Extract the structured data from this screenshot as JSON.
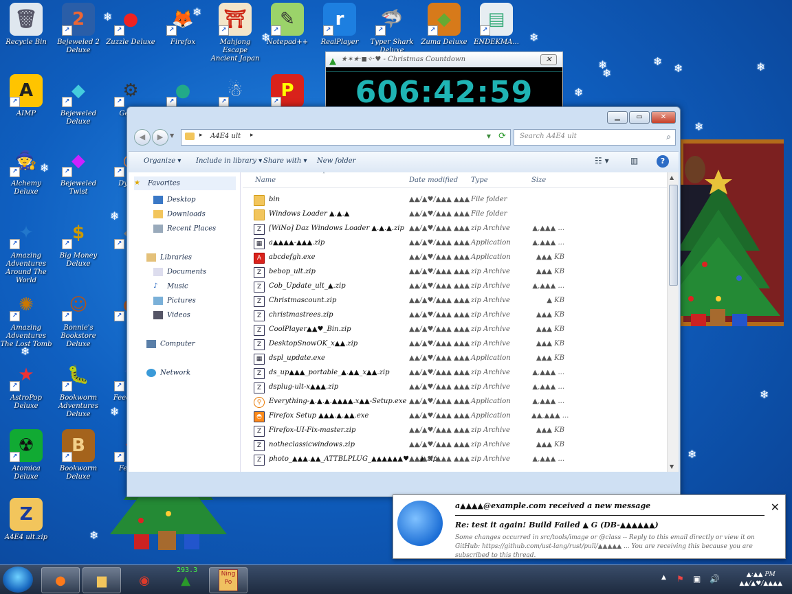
{
  "desktop_icons": [
    {
      "id": "recycle-bin",
      "label": "Recycle Bin",
      "glyph": "🗑",
      "bg": "#dfe7ef",
      "fg": "#556",
      "shortcut": false
    },
    {
      "id": "bejeweled2",
      "label": "Bejeweled 2 Deluxe",
      "glyph": "2",
      "bg": "#2a5ea8",
      "fg": "#e63"
    },
    {
      "id": "zuzzle",
      "label": "Zuzzle Deluxe",
      "glyph": "●",
      "bg": "transparent",
      "fg": "#e22"
    },
    {
      "id": "firefox",
      "label": "Firefox",
      "glyph": "🦊",
      "bg": "transparent",
      "fg": "#f70"
    },
    {
      "id": "mahjong",
      "label": "Mahjong Escape Ancient Japan",
      "glyph": "⛩",
      "bg": "#f3e5c9",
      "fg": "#c21"
    },
    {
      "id": "notepad",
      "label": "Notepad++",
      "glyph": "✎",
      "bg": "#9bd36a",
      "fg": "#333"
    },
    {
      "id": "realplayer",
      "label": "RealPlayer",
      "glyph": "r",
      "bg": "#1d7fe0",
      "fg": "#fff"
    },
    {
      "id": "typer-shark",
      "label": "Typer Shark Deluxe",
      "glyph": "🦈",
      "bg": "transparent",
      "fg": "#ccc"
    },
    {
      "id": "zuma",
      "label": "Zuma Deluxe",
      "glyph": "◆",
      "bg": "#d77a1a",
      "fg": "#6a3"
    },
    {
      "id": "endekma",
      "label": "ENDEKMA...",
      "glyph": "▤",
      "bg": "#e6edf2",
      "fg": "#3a7"
    },
    {
      "id": "aimp",
      "label": "AIMP",
      "glyph": "A",
      "bg": "#ffc400",
      "fg": "#222"
    },
    {
      "id": "bejeweled",
      "label": "Bejeweled Deluxe",
      "glyph": "◆",
      "bg": "transparent",
      "fg": "#4cd"
    },
    {
      "id": "gear",
      "label": "Gear...",
      "glyph": "⚙",
      "bg": "transparent",
      "fg": "#333"
    },
    {
      "id": "chrome",
      "label": "",
      "glyph": "●",
      "bg": "transparent",
      "fg": "#2a8"
    },
    {
      "id": "yeti",
      "label": "",
      "glyph": "☃",
      "bg": "transparent",
      "fg": "#ddd"
    },
    {
      "id": "p-game",
      "label": "",
      "glyph": "P",
      "bg": "#d9221b",
      "fg": "#ff0"
    },
    {
      "id": "alchemy",
      "label": "Alchemy Deluxe",
      "glyph": "🧙",
      "bg": "transparent",
      "fg": "#c33"
    },
    {
      "id": "bejeweled-twist",
      "label": "Bejeweled Twist",
      "glyph": "◆",
      "bg": "transparent",
      "fg": "#c2f"
    },
    {
      "id": "dyno",
      "label": "Dyno...",
      "glyph": "◎",
      "bg": "transparent",
      "fg": "#e84"
    },
    {
      "id": "aaaw",
      "label": "Amazing Adventures Around The World",
      "glyph": "✦",
      "bg": "transparent",
      "fg": "#27c"
    },
    {
      "id": "big-money",
      "label": "Big Money Deluxe",
      "glyph": "$",
      "bg": "transparent",
      "fg": "#c90"
    },
    {
      "id": "bejeweled3",
      "label": "...",
      "glyph": "◆",
      "bg": "transparent",
      "fg": "#888"
    },
    {
      "id": "aalt",
      "label": "Amazing Adventures The Lost Tomb",
      "glyph": "✺",
      "bg": "transparent",
      "fg": "#c70"
    },
    {
      "id": "bonnies",
      "label": "Bonnie's Bookstore Deluxe",
      "glyph": "☺",
      "bg": "transparent",
      "fg": "#a52"
    },
    {
      "id": "blank1",
      "label": "...",
      "glyph": "◐",
      "bg": "transparent",
      "fg": "#a52"
    },
    {
      "id": "astropop",
      "label": "AstroPop Deluxe",
      "glyph": "★",
      "bg": "transparent",
      "fg": "#e33"
    },
    {
      "id": "bookworm-adv",
      "label": "Bookworm Adventures Deluxe",
      "glyph": "🐛",
      "bg": "transparent",
      "fg": "#5b3"
    },
    {
      "id": "feeding",
      "label": "Feeding...",
      "glyph": "♆",
      "bg": "transparent",
      "fg": "#36c"
    },
    {
      "id": "atomica",
      "label": "Atomica Deluxe",
      "glyph": "☢",
      "bg": "#1a3",
      "fg": "#111"
    },
    {
      "id": "bookworm",
      "label": "Bookworm Deluxe",
      "glyph": "B",
      "bg": "#a4631c",
      "fg": "#f3d08a"
    },
    {
      "id": "feed2",
      "label": "Feed...",
      "glyph": "♦",
      "bg": "transparent",
      "fg": "#c33"
    },
    {
      "id": "zip-file",
      "label": "A4E4 ult.zip",
      "glyph": "Z",
      "bg": "#f2c55c",
      "fg": "#1a3b9c",
      "shortcut": false
    }
  ],
  "countdown": {
    "title": "★✶★·◼✧·♥ - Christmas Countdown",
    "time": "606:42:59"
  },
  "explorer": {
    "breadcrumb": "A4E4 ult",
    "search_placeholder": "Search A4E4 ult",
    "toolbar": {
      "organize": "Organize",
      "include": "Include in library",
      "share": "Share with",
      "new_folder": "New folder"
    },
    "nav": {
      "favorites": "Favorites",
      "desktop": "Desktop",
      "downloads": "Downloads",
      "recent": "Recent Places",
      "libraries": "Libraries",
      "documents": "Documents",
      "music": "Music",
      "pictures": "Pictures",
      "videos": "Videos",
      "computer": "Computer",
      "network": "Network"
    },
    "headers": {
      "name": "Name",
      "date": "Date modified",
      "type": "Type",
      "size": "Size"
    },
    "files": [
      {
        "icon": "folder",
        "name": "bin",
        "date": "▲▲/▲♥/▲▲▲ ▲▲▲",
        "type": "File folder",
        "size": ""
      },
      {
        "icon": "folder",
        "name": "Windows Loader ▲.▲.▲",
        "date": "▲▲/▲♥/▲▲▲ ▲▲▲",
        "type": "File folder",
        "size": ""
      },
      {
        "icon": "zip",
        "name": "[WiNo] Daz Windows Loader ▲.▲.▲.zip",
        "date": "▲▲/▲♥/▲▲▲ ▲▲▲",
        "type": "zip Archive",
        "size": "▲,▲▲▲ ..."
      },
      {
        "icon": "app",
        "name": "a▲▲▲▲-▲▲▲.zip",
        "date": "▲▲/▲♥/▲▲▲ ▲▲▲",
        "type": "Application",
        "size": "▲,▲▲▲ ..."
      },
      {
        "icon": "red",
        "name": "abcdefgh.exe",
        "date": "▲▲/▲♥/▲▲▲ ▲▲▲",
        "type": "Application",
        "size": "▲▲▲ KB"
      },
      {
        "icon": "zip",
        "name": "bebop_ult.zip",
        "date": "▲▲/▲♥/▲▲▲ ▲▲▲",
        "type": "zip Archive",
        "size": "▲▲▲ KB"
      },
      {
        "icon": "zip",
        "name": "Cob_Update_ult_▲.zip",
        "date": "▲▲/▲♥/▲▲▲ ▲▲▲",
        "type": "zip Archive",
        "size": "▲,▲▲▲ ..."
      },
      {
        "icon": "zip",
        "name": "Christmascount.zip",
        "date": "▲▲/▲♥/▲▲▲ ▲▲▲",
        "type": "zip Archive",
        "size": "▲ KB"
      },
      {
        "icon": "zip",
        "name": "christmastrees.zip",
        "date": "▲▲/▲♥/▲▲▲ ▲▲▲",
        "type": "zip Archive",
        "size": "▲▲▲ KB"
      },
      {
        "icon": "zip",
        "name": "CoolPlayer▲▲♥_Bin.zip",
        "date": "▲▲/▲♥/▲▲▲ ▲▲▲",
        "type": "zip Archive",
        "size": "▲▲▲ KB"
      },
      {
        "icon": "zip",
        "name": "DesktopSnowOK_x▲▲.zip",
        "date": "▲▲/▲♥/▲▲▲ ▲▲▲",
        "type": "zip Archive",
        "size": "▲▲▲ KB"
      },
      {
        "icon": "app",
        "name": "dspl_update.exe",
        "date": "▲▲/▲♥/▲▲▲ ▲▲▲",
        "type": "Application",
        "size": "▲▲▲ KB"
      },
      {
        "icon": "zip",
        "name": "ds_up▲▲▲_portable_▲.▲▲_x▲▲.zip",
        "date": "▲▲/▲♥/▲▲▲ ▲▲▲",
        "type": "zip Archive",
        "size": "▲,▲▲▲ ..."
      },
      {
        "icon": "zip",
        "name": "dsplug-ult-x▲▲▲.zip",
        "date": "▲▲/▲♥/▲▲▲ ▲▲▲",
        "type": "zip Archive",
        "size": "▲,▲▲▲ ..."
      },
      {
        "icon": "orange",
        "name": "Everything-▲.▲.▲.▲▲▲▲.x▲▲-Setup.exe",
        "date": "▲▲/▲♥/▲▲▲ ▲▲▲",
        "type": "Application",
        "size": "▲,▲▲▲ ..."
      },
      {
        "icon": "firefox",
        "name": "Firefox Setup ▲▲▲.▲.▲▲.exe",
        "date": "▲▲/▲♥/▲▲▲ ▲▲▲",
        "type": "Application",
        "size": "▲▲,▲▲▲ ..."
      },
      {
        "icon": "zip",
        "name": "Firefox-UI-Fix-master.zip",
        "date": "▲▲/▲♥/▲▲▲ ▲▲▲",
        "type": "zip Archive",
        "size": "▲▲▲ KB"
      },
      {
        "icon": "zip",
        "name": "notheclassicwindows.zip",
        "date": "▲▲/▲♥/▲▲▲ ▲▲▲",
        "type": "zip Archive",
        "size": "▲▲▲ KB"
      },
      {
        "icon": "zip",
        "name": "photo_▲▲▲.▲▲_ATTBLPLUG_▲▲▲▲▲▲♥▲▲▲.zip",
        "date": "▲▲/▲♥/▲▲▲ ▲▲▲",
        "type": "zip Archive",
        "size": "▲,▲▲▲ ..."
      }
    ]
  },
  "notification": {
    "header": "a▲▲▲▲@example.com received a new message",
    "subject": "Re: test it again! Build Failed ▲ G (DB-▲▲▲▲▲▲)",
    "body": "Some changes occurred in src/tools/image or @class -- Reply to this email directly or view it on GitHub: https://github.com/ust-lang/rust/pull/▲▲▲▲▲ ... You are receiving this because you are subscribed to this thread."
  },
  "taskbar": {
    "badge": "293.3",
    "clock_time": "▲:▲▲ PM",
    "clock_date": "▲▲/▲♥/▲▲▲▲"
  }
}
